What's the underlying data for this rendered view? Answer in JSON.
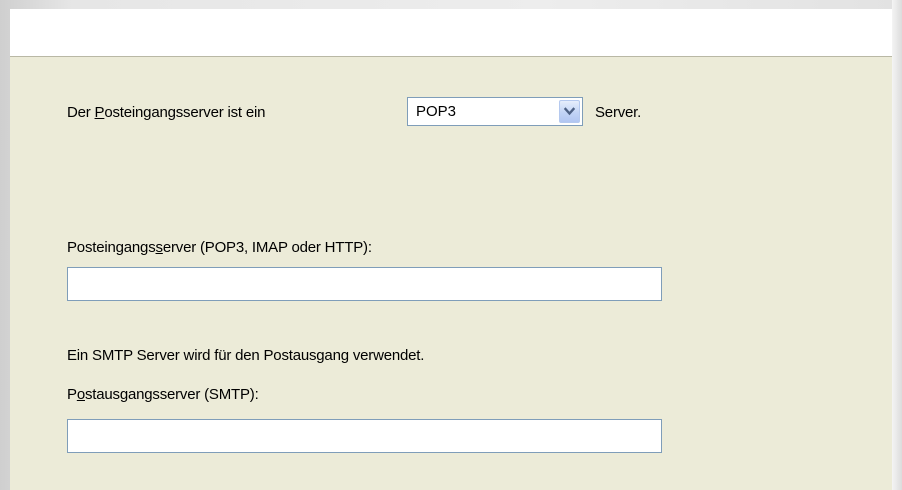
{
  "incoming_type": {
    "label_before": "Der ",
    "label_access_key": "P",
    "label_after": "osteingangsserver ist ein",
    "selected_value": "POP3",
    "suffix": "Server."
  },
  "incoming_server": {
    "label_before": "Posteingangs",
    "label_access_key": "s",
    "label_after": "erver (POP3, IMAP oder HTTP):",
    "value": ""
  },
  "smtp_info": {
    "text": "Ein SMTP Server wird für den Postausgang verwendet."
  },
  "outgoing_server": {
    "label_before": "P",
    "label_access_key": "o",
    "label_after": "stausgangsserver (SMTP):",
    "value": ""
  },
  "icons": {
    "dropdown": "chevron-down-icon"
  }
}
